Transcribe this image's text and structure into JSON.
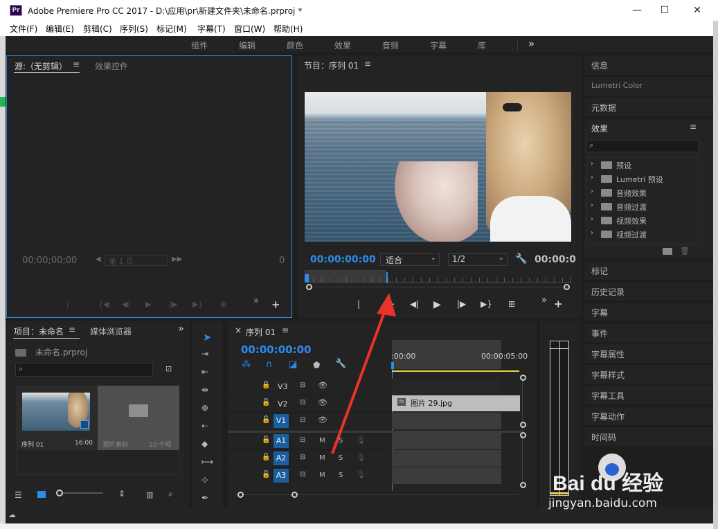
{
  "window": {
    "app_icon": "Pr",
    "title": "Adobe Premiere Pro CC 2017 - D:\\应用\\pr\\新建文件夹\\未命名.prproj *",
    "min_label": "—",
    "max_label": "☐",
    "close_label": "✕"
  },
  "menu": [
    "文件(F)",
    "编辑(E)",
    "剪辑(C)",
    "序列(S)",
    "标记(M)",
    "字幕(T)",
    "窗口(W)",
    "帮助(H)"
  ],
  "workspaces": [
    "组件",
    "编辑",
    "颜色",
    "效果",
    "音频",
    "字幕",
    "库"
  ],
  "workspace_more": "»",
  "source_panel": {
    "tab_source": "源:（无剪辑）",
    "tab_menu": "≡",
    "tab_effect_controls": "效果控件",
    "timecode": "00;00;00;00",
    "page_field": "第 1 页",
    "right_value": "0"
  },
  "program_panel": {
    "title": "节目：序列 01",
    "title_menu": "≡",
    "timecode": "00:00:00:00",
    "fit": "适合",
    "resolution": "1/2",
    "end_timecode": "00:00:0"
  },
  "project_panel": {
    "tab_project": "项目：未命名",
    "tab_menu": "≡",
    "tab_media_browser": "媒体浏览器",
    "more": "»",
    "file_name": "未命名.prproj",
    "items": [
      {
        "name": "序列 01",
        "meta": "16:00"
      },
      {
        "name": "图片素材",
        "meta": "10 个项"
      }
    ]
  },
  "timeline": {
    "close": "×",
    "tab": "序列 01",
    "tab_menu": "≡",
    "timecode": "00:00:00:00",
    "ruler_start": ":00:00",
    "ruler_end": "00:00:05:00",
    "video_tracks": [
      "V3",
      "V2",
      "V1"
    ],
    "audio_tracks": [
      "A1",
      "A2",
      "A3"
    ],
    "track_m": "M",
    "track_s": "S",
    "clip_label": "图片 29.jpg",
    "clip_fx": "fx"
  },
  "right_panel": {
    "info": "信息",
    "lumetri_color": "Lumetri Color",
    "metadata": "元数据",
    "effects": "效果",
    "effects_menu": "≡",
    "effect_folders": [
      "预设",
      "Lumetri 预设",
      "音频效果",
      "音频过渡",
      "视频效果",
      "视频过渡"
    ],
    "lower_items": [
      "标记",
      "历史记录",
      "字幕",
      "事件",
      "字幕属性",
      "字幕样式",
      "字幕工具",
      "字幕动作",
      "时间码"
    ]
  },
  "watermark": {
    "brand": "Bai du 经验",
    "url": "jingyan.baidu.com"
  },
  "colors": {
    "accent_blue": "#2d8ceb",
    "playhead": "#2d8ceb",
    "arrow_red": "#e8332c",
    "track_blue": "#1a5e9e",
    "clip_gray": "#bdbdbd"
  }
}
